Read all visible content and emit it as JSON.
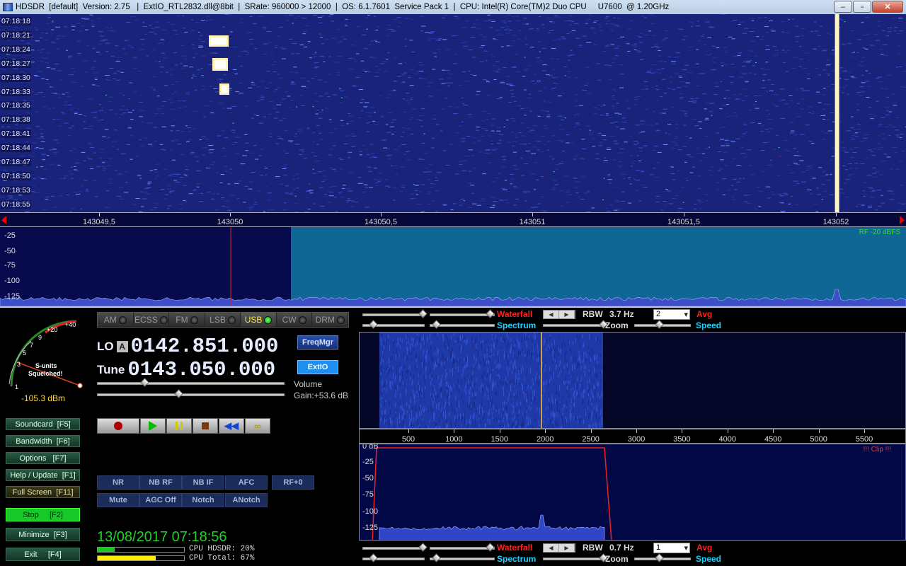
{
  "window": {
    "title": "HDSDR  [default]  Version: 2.75   |  ExtIO_RTL2832.dll@8bit  |  SRate: 960000 > 12000  |  OS: 6.1.7601  Service Pack 1  |  CPU: Intel(R) Core(TM)2 Duo CPU     U7600  @ 1.20GHz",
    "controls": {
      "minimize": "–",
      "maximize": "▫",
      "close": "✕"
    }
  },
  "waterfall_top": {
    "times": [
      "07:18:18",
      "07:18:21",
      "07:18:24",
      "07:18:27",
      "07:18:30",
      "07:18:33",
      "07:18:35",
      "07:18:38",
      "07:18:41",
      "07:18:44",
      "07:18:47",
      "07:18:50",
      "07:18:53",
      "07:18:55"
    ]
  },
  "freq_scale_top": {
    "ticks": [
      "143049,5",
      "143050",
      "143050,5",
      "143051",
      "143051,5",
      "143052"
    ]
  },
  "spectrum_top": {
    "y_ticks": [
      "-25",
      "-50",
      "-75",
      "-100",
      "-125"
    ],
    "rf_label": "RF -20 dBFS"
  },
  "smeter": {
    "scale_labels": [
      "1",
      "3",
      "5",
      "7",
      "9",
      "+20",
      "+40"
    ],
    "status_line1": "S-units",
    "status_line2": "Squelched!",
    "dbm": "-105.3 dBm"
  },
  "left_buttons": {
    "soundcard": "Soundcard  [F5]",
    "bandwidth": "Bandwidth  [F6]",
    "options": "Options   [F7]",
    "help": "Help / Update  [F1]",
    "fullscreen": "Full Screen  [F11]",
    "stop": "Stop     [F2]",
    "minimize": "Minimize  [F3]",
    "exit": "Exit     [F4]"
  },
  "modes": [
    {
      "label": "AM",
      "active": false
    },
    {
      "label": "ECSS",
      "active": false
    },
    {
      "label": "FM",
      "active": false
    },
    {
      "label": "LSB",
      "active": false
    },
    {
      "label": "USB",
      "active": true
    },
    {
      "label": "CW",
      "active": false
    },
    {
      "label": "DRM",
      "active": false
    }
  ],
  "frequency": {
    "lo_label": "LO",
    "lo_a": "A",
    "lo_value": "0142.851.000",
    "tune_label": "Tune",
    "tune_value": "0143.050.000",
    "freqmgr": "FreqMgr",
    "extio": "ExtIO"
  },
  "audio": {
    "volume_label": "Volume",
    "gain_label": "Gain:+53.6 dB",
    "volume_level": 0.25,
    "gain_level": 0.43
  },
  "dsp_buttons": {
    "row1": [
      "NR",
      "NB RF",
      "NB IF",
      "AFC",
      "RF+0"
    ],
    "row2": [
      "Mute",
      "AGC Off",
      "Notch",
      "ANotch"
    ]
  },
  "status": {
    "datetime": "13/08/2017 07:18:56",
    "cpu_hdsdr": "CPU HDSDR: 20%",
    "cpu_total": "CPU Total: 67%",
    "cpu_hdsdr_pct": 20,
    "cpu_total_pct": 67,
    "colors": {
      "cpu_hdsdr": "#16c922",
      "cpu_total": "#ffee00"
    }
  },
  "top_controls": {
    "waterfall": "Waterfall",
    "spectrum": "Spectrum",
    "rbw_label": "RBW",
    "rbw_value": "3.7 Hz",
    "zoom": "Zoom",
    "avg": "Avg",
    "speed": "Speed",
    "avg_value": "2"
  },
  "bottom_controls": {
    "waterfall": "Waterfall",
    "spectrum": "Spectrum",
    "rbw_label": "RBW",
    "rbw_value": "0.7 Hz",
    "zoom": "Zoom",
    "avg": "Avg",
    "speed": "Speed",
    "avg_value": "1"
  },
  "audio_scale": {
    "ticks": [
      "500",
      "1000",
      "1500",
      "2000",
      "2500",
      "3000",
      "3500",
      "4000",
      "4500",
      "5000",
      "5500"
    ]
  },
  "audio_spectrum": {
    "y_ticks": [
      "0 dB",
      "-25",
      "-50",
      "-75",
      "-100",
      "-125"
    ],
    "clip": "!!! Clip !!!"
  },
  "icons": {
    "record": "record-icon",
    "play": "play-icon",
    "pause": "pause-icon",
    "stop": "stop-icon",
    "rewind": "rewind-icon",
    "loop": "loop-icon"
  }
}
